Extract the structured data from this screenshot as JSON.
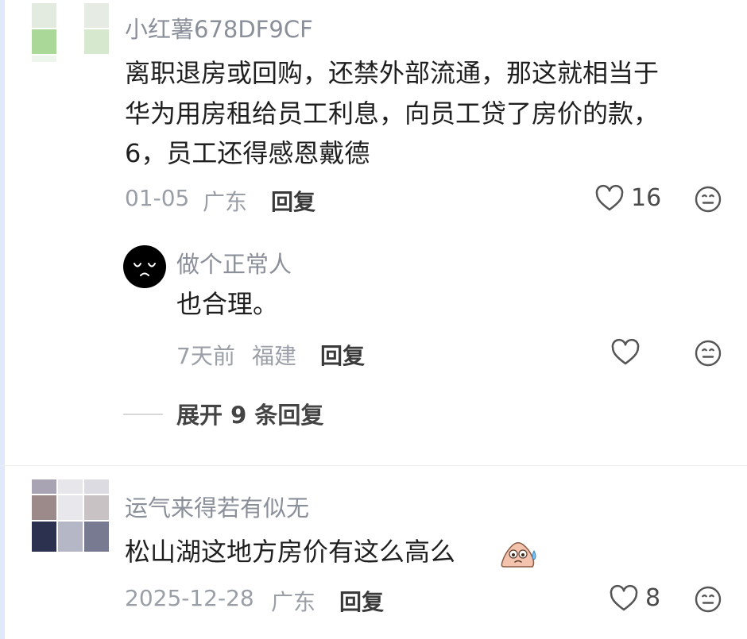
{
  "comments": [
    {
      "username": "小红薯678DF9CF",
      "lines": [
        "离职退房或回购，还禁外部流通，那这就相当于",
        "华为用房租给员工利息，向员工贷了房价的款，",
        "6，员工还得感恩戴德"
      ],
      "date": "01-05",
      "location": "广东",
      "reply_label": "回复",
      "likes": "16"
    },
    {
      "username": "运气来得若有似无",
      "lines": [
        "松山湖这地方房价有这么高么"
      ],
      "date": "2025-12-28",
      "location": "广东",
      "reply_label": "回复",
      "likes": "8"
    }
  ],
  "sub_reply": {
    "username": "做个正常人",
    "text": "也合理。",
    "time": "7天前",
    "location": "福建",
    "reply_label": "回复"
  },
  "expand_replies_label": "展开 9 条回复",
  "icons": {
    "like": "heart-outline-icon",
    "react": "smiley-face-icon",
    "inline_emoji": "sweat-emoji-icon",
    "avatar": "black-face-avatar"
  },
  "colors": {
    "muted_text": "#9a9ea6",
    "username": "#8a8f99",
    "body_text": "#1f1f1f",
    "icon_stroke": "#555555"
  }
}
